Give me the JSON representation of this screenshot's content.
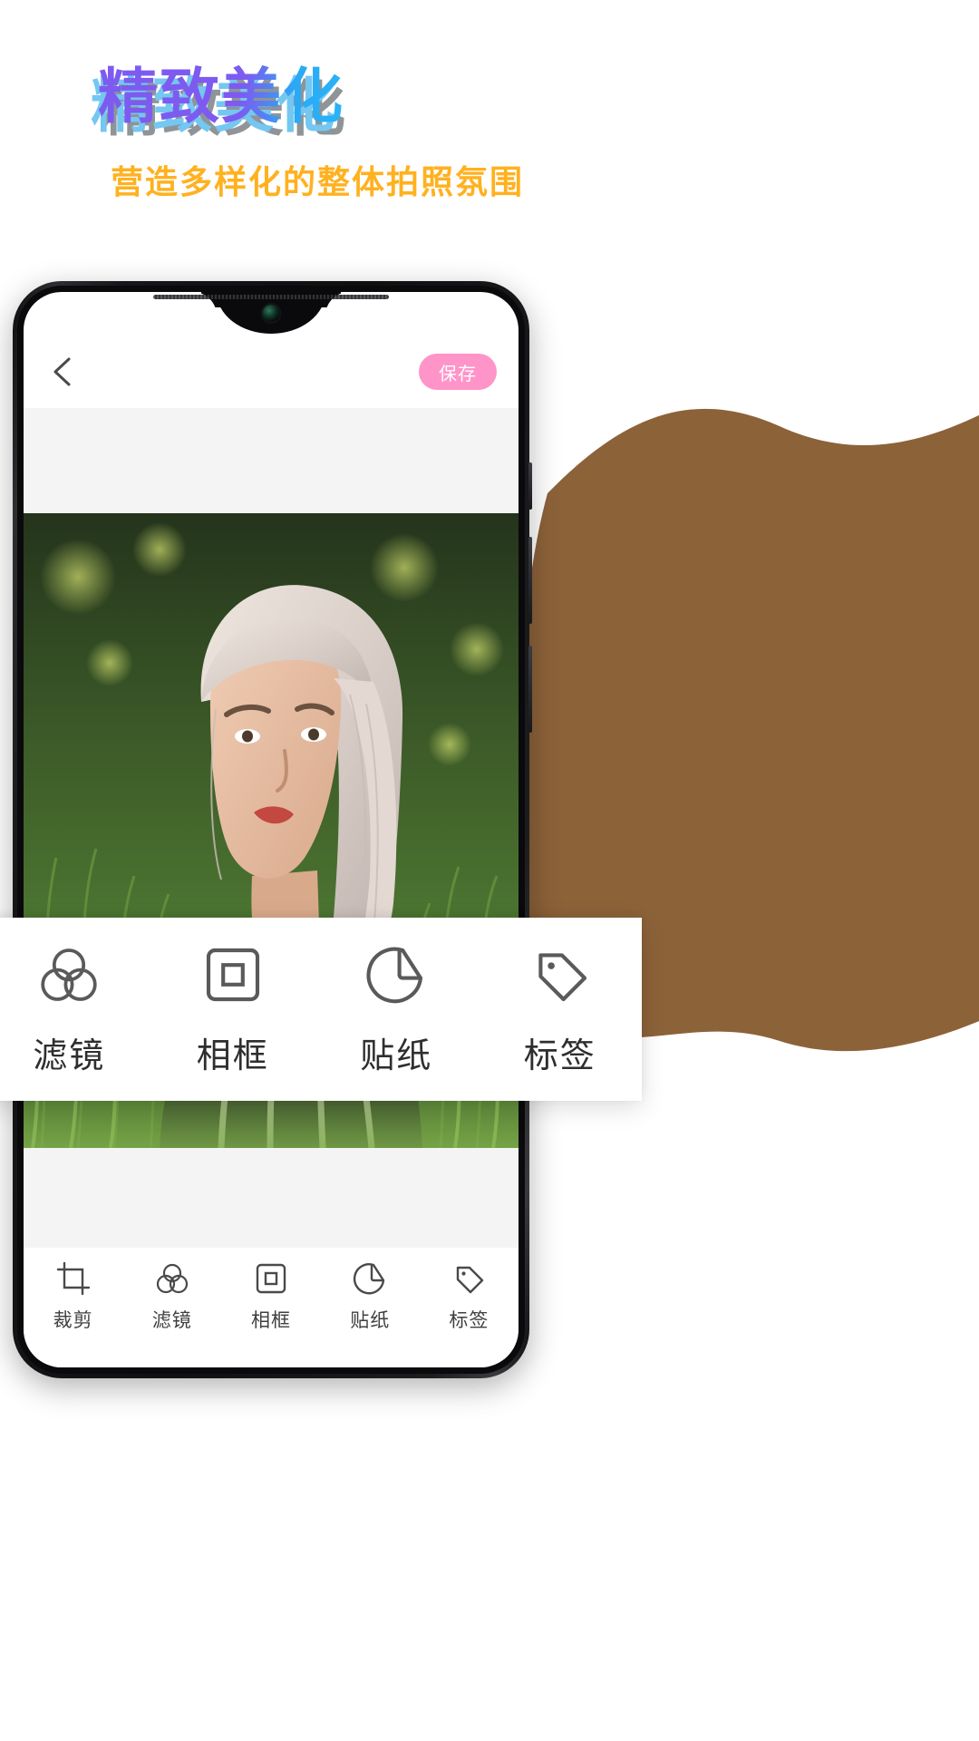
{
  "promo": {
    "title": "精致美化",
    "subtitle": "营造多样化的整体拍照氛围",
    "title_gradient_from": "#7d5bf0",
    "title_gradient_to": "#2ab4f7",
    "title_shadow_color": "#74c7f0",
    "subtitle_color": "#ffb11f"
  },
  "phone_app": {
    "header": {
      "back_icon": "chevron-left-icon",
      "save_label": "保存",
      "save_button_color": "#ff94c8"
    },
    "bottom_nav": [
      {
        "label": "裁剪",
        "icon": "crop-icon"
      },
      {
        "label": "滤镜",
        "icon": "filter-circles-icon"
      },
      {
        "label": "相框",
        "icon": "frame-icon"
      },
      {
        "label": "贴纸",
        "icon": "sticker-icon"
      },
      {
        "label": "标签",
        "icon": "tag-icon"
      }
    ]
  },
  "popup_menu": {
    "items": [
      {
        "label": "滤镜",
        "icon": "filter-circles-icon"
      },
      {
        "label": "相框",
        "icon": "frame-icon"
      },
      {
        "label": "贴纸",
        "icon": "sticker-icon"
      },
      {
        "label": "标签",
        "icon": "tag-icon"
      }
    ]
  },
  "decor": {
    "blob_color": "#8c6239"
  }
}
